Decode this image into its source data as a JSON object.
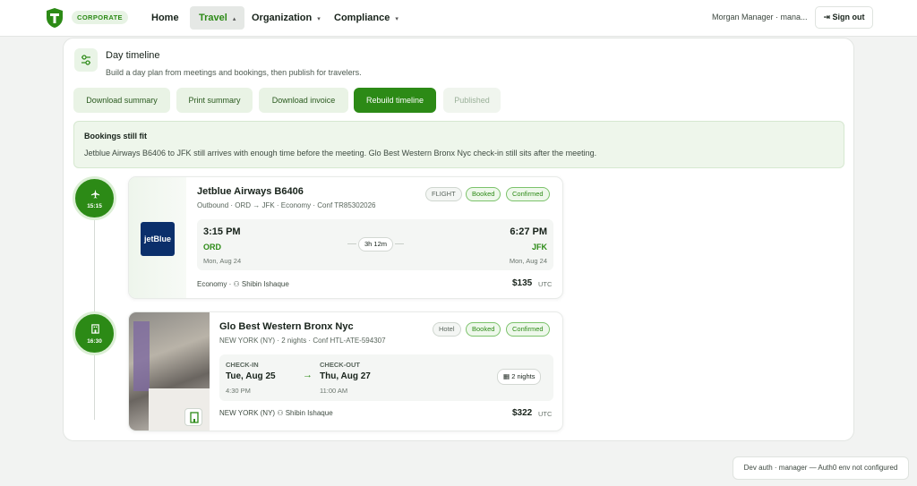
{
  "header": {
    "brand_badge": "CORPORATE",
    "nav": [
      {
        "label": "Home"
      },
      {
        "label": "Travel"
      },
      {
        "label": "Organization"
      },
      {
        "label": "Compliance"
      }
    ],
    "user_label": "Morgan Manager · mana...",
    "sign_out": "Sign out"
  },
  "page": {
    "title": "Day timeline",
    "subtitle": "Build a day plan from meetings and bookings, then publish for travelers.",
    "buttons": [
      "Download summary",
      "Print summary",
      "Download invoice",
      "Rebuild timeline",
      "Published"
    ]
  },
  "notice": {
    "title": "Bookings still fit",
    "text": "Jetblue Airways B6406 to JFK still arrives with enough time before the meeting. Glo Best Western Bronx Nyc check-in still sits after the meeting."
  },
  "timeline": [
    {
      "time": "15:15",
      "icon": "plane-icon"
    },
    {
      "time": "16:30",
      "icon": "building-icon"
    }
  ],
  "flight": {
    "logo_text": "jetBlue",
    "title": "Jetblue Airways B6406",
    "sub": "Outbound · ORD → JFK · Economy · Conf TR85302026",
    "pills": [
      "FLIGHT",
      "Booked",
      "Confirmed"
    ],
    "dep_time": "3:15 PM",
    "dep_code": "ORD",
    "dep_date": "Mon, Aug 24",
    "duration": "3h 12m",
    "arr_time": "6:27 PM",
    "arr_code": "JFK",
    "arr_date": "Mon, Aug 24",
    "cabin": "Economy",
    "traveler": "Shibin Ishaque",
    "price": "$135",
    "currency": "UTC"
  },
  "hotel": {
    "title": "Glo Best Western Bronx Nyc",
    "sub": "NEW YORK (NY) · 2 nights · Conf HTL-ATE-594307",
    "pills": [
      "Hotel",
      "Booked",
      "Confirmed"
    ],
    "checkin_label": "CHECK-IN",
    "checkin_date": "Tue, Aug 25",
    "checkin_time": "4:30 PM",
    "checkout_label": "CHECK-OUT",
    "checkout_date": "Thu, Aug 27",
    "checkout_time": "11:00 AM",
    "nights": "2 nights",
    "city": "NEW YORK (NY)",
    "traveler": "Shibin Ishaque",
    "price": "$322",
    "currency": "UTC"
  },
  "toast": "Dev auth · manager — Auth0 env not configured",
  "colors": {
    "accent": "#2c8a16",
    "accent_light": "#e9f3e5",
    "jetblue": "#0b2f6b"
  }
}
